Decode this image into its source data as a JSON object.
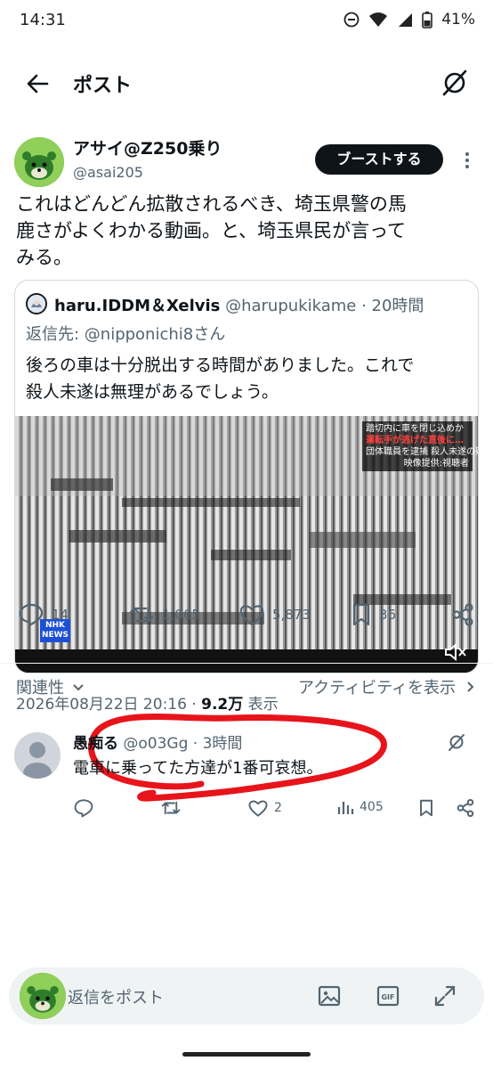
{
  "status_bar": {
    "time": "14:31",
    "battery": "41%"
  },
  "header": {
    "title": "ポスト"
  },
  "post": {
    "author_name": "アサイ@Z250乗り",
    "author_handle": "@asai205",
    "boost_label": "ブーストする",
    "text_line1": "これはどんどん拡散されるべき、埼玉県警の馬",
    "text_line2": "鹿さがよくわかる動画。と、埼玉県民が言って",
    "text_line3": "みる。",
    "timestamp": "2026年08月22日 20:16 · ",
    "views": "9.2万",
    "views_label": " 表示",
    "replies": "14",
    "reposts": "1,065",
    "likes": "5,873",
    "bookmarks": "36"
  },
  "quote": {
    "author_name": "haru.IDDM＆Xelvis",
    "author_meta": " @harupukikame · 20時間",
    "reply_to": "返信先: @nipponichi8さん",
    "text_line1": "後ろの車は十分脱出する時間がありました。これで",
    "text_line2": "殺人未遂は無理があるでしょう。",
    "caption_line1": "踏切内に車を閉じ込めか",
    "caption_line2": "運転手が逃げた直後に…",
    "caption_line3": "団体職員を逮捕 殺人未遂の疑い",
    "caption_line4": "映像提供:視聴者",
    "logo_line1": "NHK",
    "logo_line2": "NEWS"
  },
  "sort": {
    "left_label": "関連性",
    "right_label": "アクティビティを表示"
  },
  "reply": {
    "author_name": "愚痴る",
    "author_meta": " @o03Gg · 3時間",
    "text": "電車に乗ってた方達が1番可哀想。",
    "likes": "2",
    "views": "405"
  },
  "compose": {
    "placeholder": "返信をポスト"
  },
  "colors": {
    "annotation": "#e8141b",
    "boost_bg": "#0f1419"
  }
}
